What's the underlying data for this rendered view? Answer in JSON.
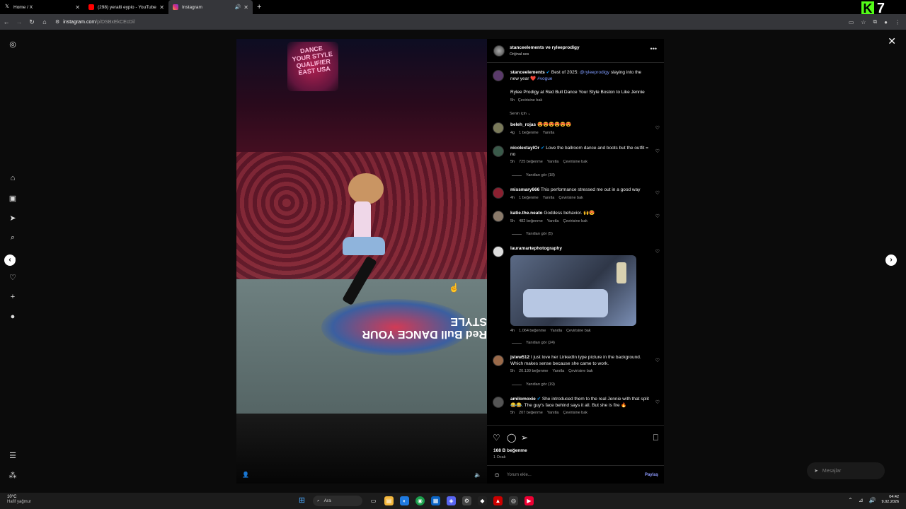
{
  "browser": {
    "tabs": [
      {
        "title": "Home / X",
        "favicon": "x-icon",
        "active": false
      },
      {
        "title": "(298) yeralti eypio - YouTube",
        "favicon": "youtube-icon",
        "active": false
      },
      {
        "title": "Instagram",
        "favicon": "instagram-icon",
        "active": true
      }
    ],
    "new_tab": "+",
    "url_host": "instagram.com",
    "url_path": "/p/DSBxEkCEcDi/",
    "overlay_badge": {
      "k": "K",
      "num": "7"
    }
  },
  "post": {
    "header_names": "stanceelements ve ryleeprodigy",
    "header_audio": "Orijinal ses",
    "caption_user": "stanceelements",
    "caption_text": "Best of 2025:",
    "caption_mention": "@ryleeprodigy",
    "caption_text2": "slaying into the new year",
    "caption_tag": "#vogue",
    "caption_line2": "Rylee Prodigy at Red Bull Dance Your Style Boston to Like Jennie",
    "caption_time": "5h",
    "caption_translate": "Çevirisine bak",
    "for_you": "Senin için",
    "video_banner": "DANCE YOUR STYLE QUALIFIER EAST USA",
    "video_floor_logo": "Red Bull DANCE YOUR STYLE"
  },
  "comments": [
    {
      "user": "beleh_rojas",
      "text": "😍😍😍😍😍😍",
      "time": "4g",
      "likes": "1 beğenme",
      "reply": "Yanıtla",
      "translate": ""
    },
    {
      "user": "nicolextaylOr",
      "text": "Love the ballroom dance and boots but the outfit = no",
      "time": "5h",
      "likes": "725 beğenme",
      "reply": "Yanıtla",
      "translate": "Çevirisine bak",
      "replies": "Yanıtları gör (18)"
    },
    {
      "user": "missmary666",
      "text": "This performance stressed me out in a good way",
      "time": "4h",
      "likes": "1 beğenme",
      "reply": "Yanıtla",
      "translate": "Çevirisine bak"
    },
    {
      "user": "katie.the.neato",
      "text": "Goddess behavior. 🙌😍",
      "time": "5h",
      "likes": "482 beğenme",
      "reply": "Yanıtla",
      "translate": "Çevirisine bak",
      "replies": "Yanıtları gör (5)"
    },
    {
      "user": "lauramartephotography",
      "text": "",
      "time": "4h",
      "likes": "1.064 beğenme",
      "reply": "Yanıtla",
      "translate": "Çevirisine bak",
      "replies": "Yanıtları gör (24)"
    },
    {
      "user": "jstew512",
      "text": "I just love her LinkedIn type picture in the background. Which makes sense because she came to work.",
      "time": "5h",
      "likes": "20.130 beğenme",
      "reply": "Yanıtla",
      "translate": "Çevirisine bak",
      "replies": "Yanıtları gör (19)"
    },
    {
      "user": "amilomoxie",
      "text": "She introduced them to the real Jennie with that split 😂😂. The guy's face behind says it all. But she is fire 🔥",
      "time": "5h",
      "likes": "207 beğenme",
      "reply": "Yanıtla",
      "translate": "Çevirisine bak"
    }
  ],
  "footer": {
    "likes": "168 B beğenme",
    "date": "1 Ocak",
    "add_comment": "Yorum ekle...",
    "share": "Paylaş"
  },
  "messages_pill": "Mesajlar",
  "taskbar": {
    "temp": "10°C",
    "weather": "Hafif yağmur",
    "search": "Ara",
    "time": "04:42",
    "date": "9.02.2026"
  },
  "colors": {
    "accent": "#0095f6",
    "mention": "#7f9cff",
    "kick": "#53fc18"
  }
}
